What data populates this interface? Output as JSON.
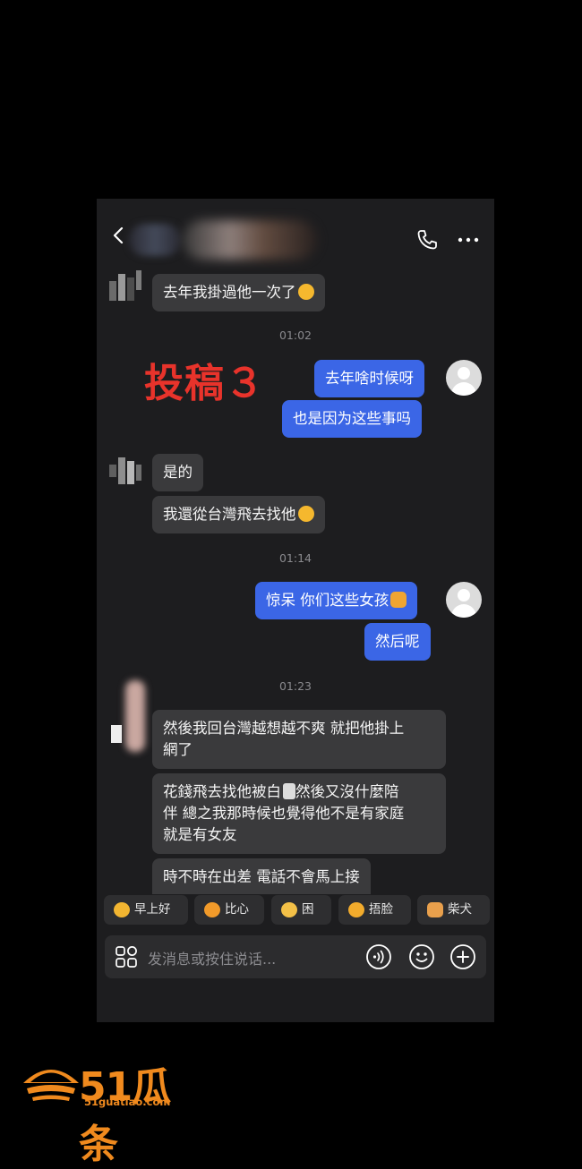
{
  "header": {
    "back_icon": "chevron-left-icon",
    "call_icon": "phone-icon",
    "more_icon": "more-icon"
  },
  "stamp": {
    "text": "投稿３"
  },
  "messages": [
    {
      "side": "in",
      "text": "去年我掛過他一次了",
      "emoji": "yawn-emoji"
    },
    {
      "time": "01:02"
    },
    {
      "side": "out",
      "text": "去年啥时候呀"
    },
    {
      "side": "out",
      "text": "也是因为这些事吗"
    },
    {
      "side": "in",
      "text": "是的"
    },
    {
      "side": "in",
      "text": "我還從台灣飛去找他",
      "emoji": "yawn-emoji"
    },
    {
      "time": "01:14"
    },
    {
      "side": "out",
      "text": "惊呆 你们这些女孩",
      "emoji": "thumbs-up-emoji"
    },
    {
      "side": "out",
      "text": "然后呢"
    },
    {
      "time": "01:23"
    },
    {
      "side": "in",
      "text": "然後我回台灣越想越不爽 就把他掛上網了"
    },
    {
      "side": "in",
      "text": "花錢飛去找他被白",
      "tail": "然後又沒什麼陪伴 總之我那時候也覺得他不是有家庭就是有女友",
      "emoji": "toilet-emoji"
    },
    {
      "side": "in",
      "text": "時不時在出差 電話不會馬上接"
    }
  ],
  "texts": {
    "m1": "去年我掛過他一次了",
    "t1": "01:02",
    "m2": "去年啥时候呀",
    "m3": "也是因为这些事吗",
    "m4": "是的",
    "m5": "我還從台灣飛去找他",
    "t2": "01:14",
    "m6": "惊呆 你们这些女孩",
    "m7": "然后呢",
    "t3": "01:23",
    "m8a": "然後我回台灣越想越不爽 就把他掛上",
    "m8b": "網了",
    "m9a": "花錢飛去找他被白",
    "m9b": "然後又沒什麼陪",
    "m9c": "伴 總之我那時候也覺得他不是有家庭",
    "m9d": "就是有女友",
    "m10": "時不時在出差 電話不會馬上接"
  },
  "quick_replies": [
    {
      "label": "早上好",
      "icon": "sun-face-icon"
    },
    {
      "label": "比心",
      "icon": "heart-hand-icon"
    },
    {
      "label": "困",
      "icon": "sleepy-face-icon"
    },
    {
      "label": "捂脸",
      "icon": "facepalm-icon"
    },
    {
      "label": "柴犬",
      "icon": "shiba-dog-icon"
    }
  ],
  "input": {
    "placeholder": "发消息或按住说话..."
  },
  "watermark": {
    "brand": "51瓜条",
    "url": "51guatiao.com"
  },
  "colors": {
    "accent": "#3b66e6",
    "stamp": "#e8332b",
    "brand": "#f08a1e"
  }
}
